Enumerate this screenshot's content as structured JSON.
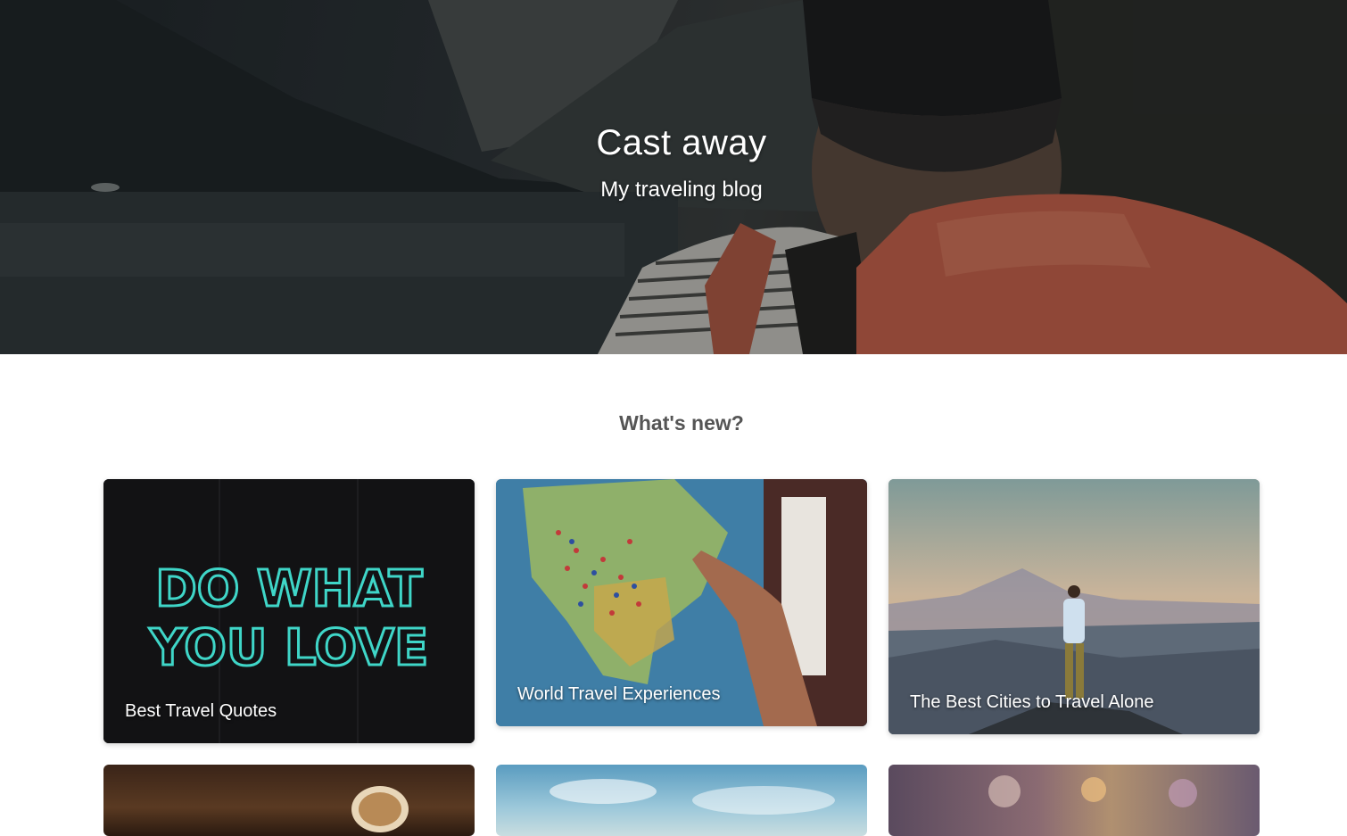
{
  "hero": {
    "title": "Cast away",
    "subtitle": "My traveling blog"
  },
  "section": {
    "title": "What's new?"
  },
  "posts": [
    {
      "title": "Best Travel Quotes",
      "image": "neon-sign-do-what-you-love",
      "sign_text": [
        "DO WHAT",
        "YOU LOVE"
      ]
    },
    {
      "title": "World Travel Experiences",
      "image": "world-map-with-pins"
    },
    {
      "title": "The Best Cities to Travel Alone",
      "image": "hiker-on-mountain-at-sunset"
    },
    {
      "title": "",
      "image": "coffee-cup-on-wood"
    },
    {
      "title": "",
      "image": "sky-with-clouds"
    },
    {
      "title": "",
      "image": "blurred-city-lights"
    }
  ],
  "colors": {
    "neon": "#3fd6c8",
    "backpack": "#d0694e",
    "section_title": "#555555"
  }
}
